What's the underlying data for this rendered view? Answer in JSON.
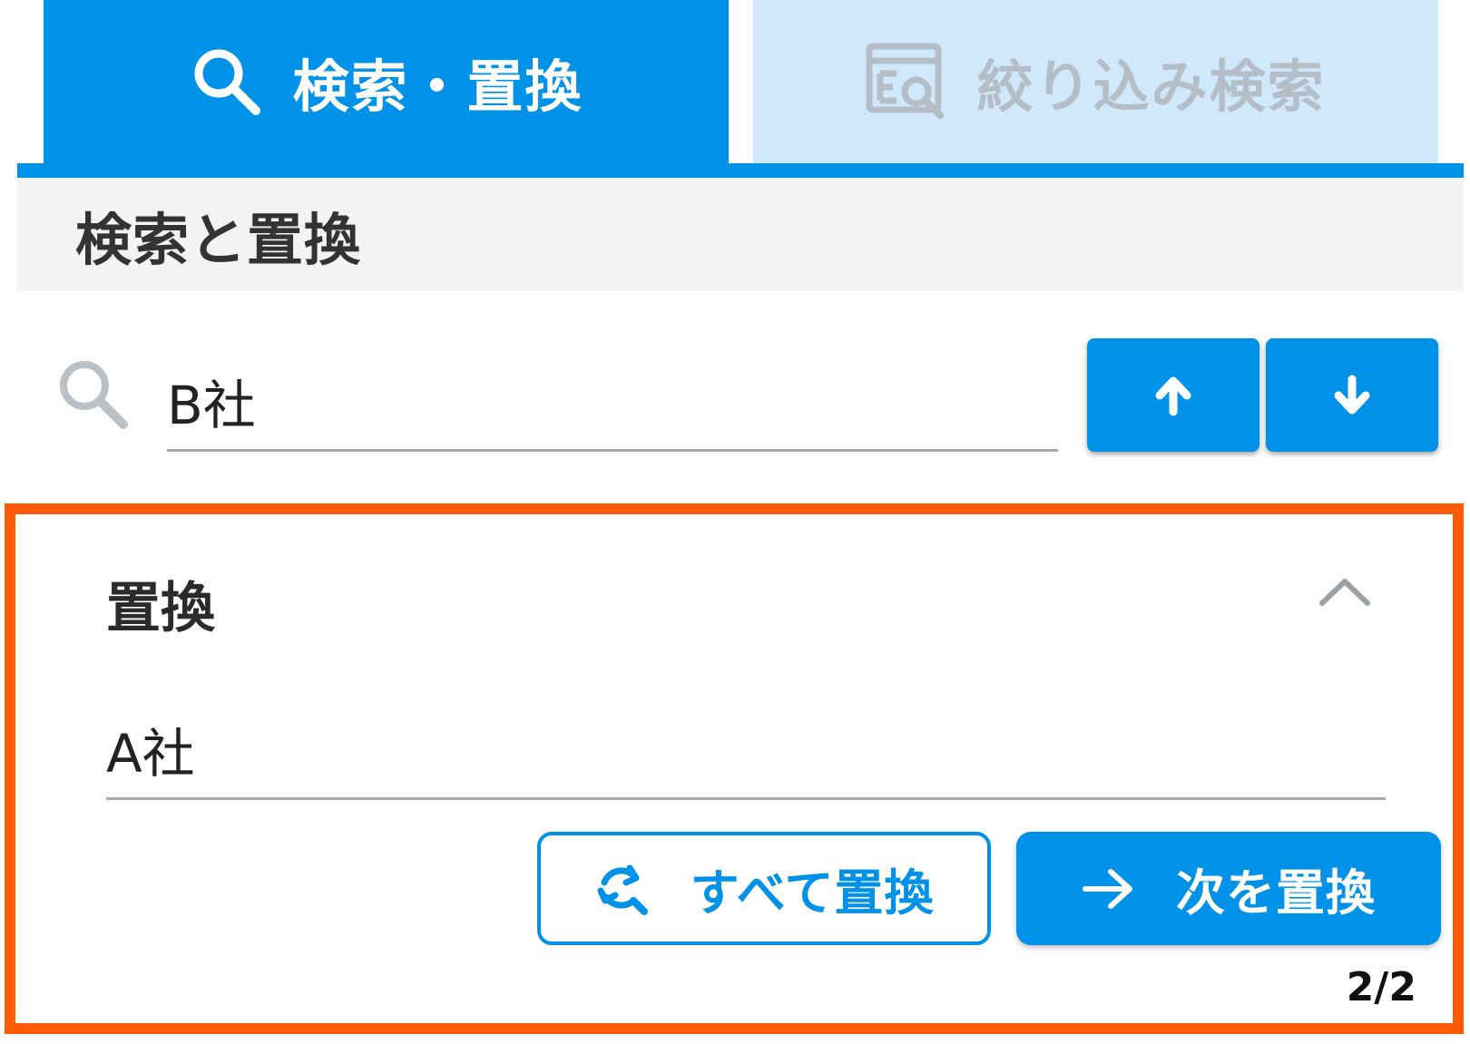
{
  "tabs": [
    {
      "label": "検索・置換",
      "icon": "search-icon",
      "active": true
    },
    {
      "label": "絞り込み検索",
      "icon": "filter-search-icon",
      "active": false
    }
  ],
  "section": {
    "title": "検索と置換"
  },
  "search": {
    "value": "B社",
    "icon": "search-icon"
  },
  "nav": {
    "prev_icon": "arrow-up-icon",
    "next_icon": "arrow-down-icon"
  },
  "replace": {
    "title": "置換",
    "toggle_icon": "chevron-up-icon",
    "value": "A社",
    "replace_all_label": "すべて置換",
    "replace_all_icon": "replace-all-icon",
    "replace_next_label": "次を置換",
    "replace_next_icon": "arrow-right-icon",
    "match_count": "2/2"
  },
  "colors": {
    "accent": "#0091e8",
    "tab_inactive_bg": "#cfe8fc",
    "highlight": "#ff5a05",
    "header_bg": "#f3f3f3"
  }
}
